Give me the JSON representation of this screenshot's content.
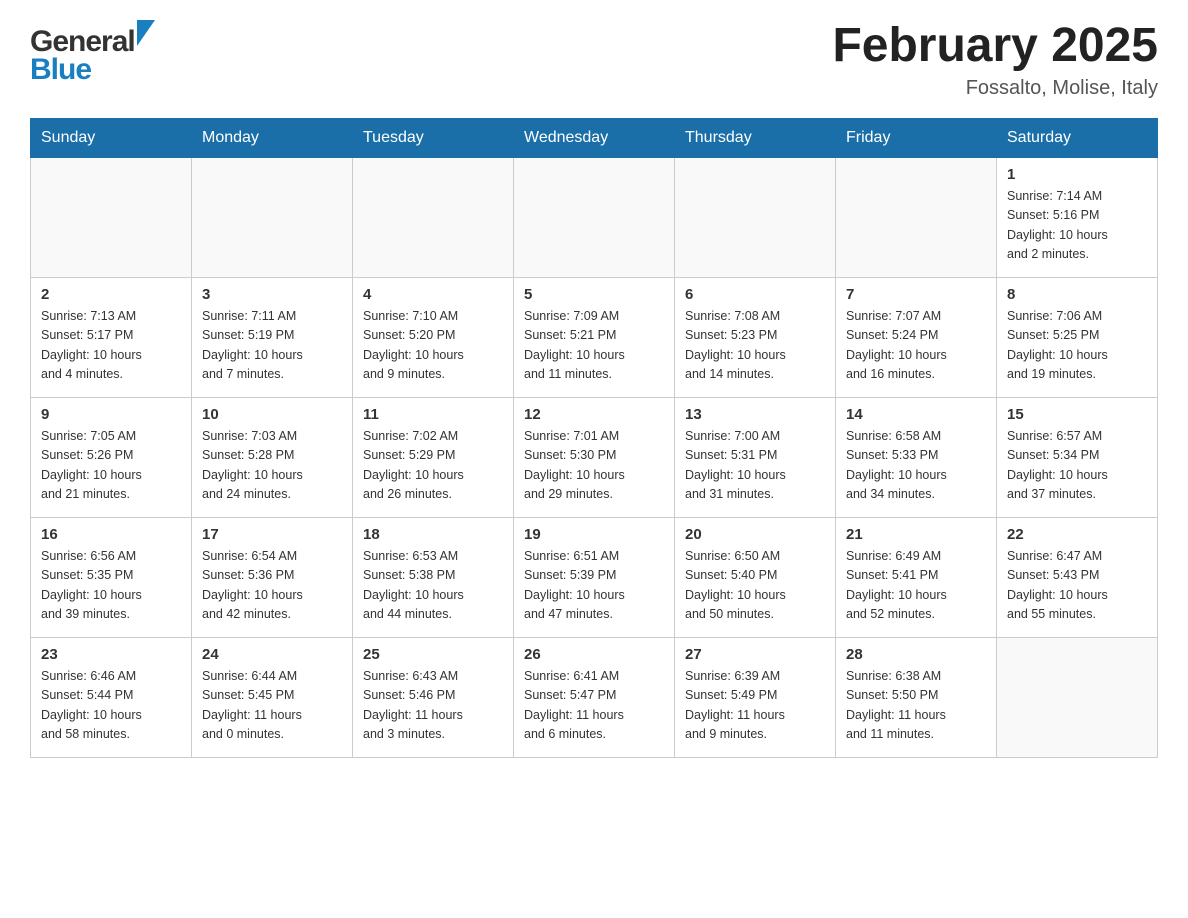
{
  "header": {
    "logo_general": "General",
    "logo_blue": "Blue",
    "title": "February 2025",
    "location": "Fossalto, Molise, Italy"
  },
  "calendar": {
    "days_of_week": [
      "Sunday",
      "Monday",
      "Tuesday",
      "Wednesday",
      "Thursday",
      "Friday",
      "Saturday"
    ],
    "weeks": [
      [
        {
          "day": "",
          "info": ""
        },
        {
          "day": "",
          "info": ""
        },
        {
          "day": "",
          "info": ""
        },
        {
          "day": "",
          "info": ""
        },
        {
          "day": "",
          "info": ""
        },
        {
          "day": "",
          "info": ""
        },
        {
          "day": "1",
          "info": "Sunrise: 7:14 AM\nSunset: 5:16 PM\nDaylight: 10 hours\nand 2 minutes."
        }
      ],
      [
        {
          "day": "2",
          "info": "Sunrise: 7:13 AM\nSunset: 5:17 PM\nDaylight: 10 hours\nand 4 minutes."
        },
        {
          "day": "3",
          "info": "Sunrise: 7:11 AM\nSunset: 5:19 PM\nDaylight: 10 hours\nand 7 minutes."
        },
        {
          "day": "4",
          "info": "Sunrise: 7:10 AM\nSunset: 5:20 PM\nDaylight: 10 hours\nand 9 minutes."
        },
        {
          "day": "5",
          "info": "Sunrise: 7:09 AM\nSunset: 5:21 PM\nDaylight: 10 hours\nand 11 minutes."
        },
        {
          "day": "6",
          "info": "Sunrise: 7:08 AM\nSunset: 5:23 PM\nDaylight: 10 hours\nand 14 minutes."
        },
        {
          "day": "7",
          "info": "Sunrise: 7:07 AM\nSunset: 5:24 PM\nDaylight: 10 hours\nand 16 minutes."
        },
        {
          "day": "8",
          "info": "Sunrise: 7:06 AM\nSunset: 5:25 PM\nDaylight: 10 hours\nand 19 minutes."
        }
      ],
      [
        {
          "day": "9",
          "info": "Sunrise: 7:05 AM\nSunset: 5:26 PM\nDaylight: 10 hours\nand 21 minutes."
        },
        {
          "day": "10",
          "info": "Sunrise: 7:03 AM\nSunset: 5:28 PM\nDaylight: 10 hours\nand 24 minutes."
        },
        {
          "day": "11",
          "info": "Sunrise: 7:02 AM\nSunset: 5:29 PM\nDaylight: 10 hours\nand 26 minutes."
        },
        {
          "day": "12",
          "info": "Sunrise: 7:01 AM\nSunset: 5:30 PM\nDaylight: 10 hours\nand 29 minutes."
        },
        {
          "day": "13",
          "info": "Sunrise: 7:00 AM\nSunset: 5:31 PM\nDaylight: 10 hours\nand 31 minutes."
        },
        {
          "day": "14",
          "info": "Sunrise: 6:58 AM\nSunset: 5:33 PM\nDaylight: 10 hours\nand 34 minutes."
        },
        {
          "day": "15",
          "info": "Sunrise: 6:57 AM\nSunset: 5:34 PM\nDaylight: 10 hours\nand 37 minutes."
        }
      ],
      [
        {
          "day": "16",
          "info": "Sunrise: 6:56 AM\nSunset: 5:35 PM\nDaylight: 10 hours\nand 39 minutes."
        },
        {
          "day": "17",
          "info": "Sunrise: 6:54 AM\nSunset: 5:36 PM\nDaylight: 10 hours\nand 42 minutes."
        },
        {
          "day": "18",
          "info": "Sunrise: 6:53 AM\nSunset: 5:38 PM\nDaylight: 10 hours\nand 44 minutes."
        },
        {
          "day": "19",
          "info": "Sunrise: 6:51 AM\nSunset: 5:39 PM\nDaylight: 10 hours\nand 47 minutes."
        },
        {
          "day": "20",
          "info": "Sunrise: 6:50 AM\nSunset: 5:40 PM\nDaylight: 10 hours\nand 50 minutes."
        },
        {
          "day": "21",
          "info": "Sunrise: 6:49 AM\nSunset: 5:41 PM\nDaylight: 10 hours\nand 52 minutes."
        },
        {
          "day": "22",
          "info": "Sunrise: 6:47 AM\nSunset: 5:43 PM\nDaylight: 10 hours\nand 55 minutes."
        }
      ],
      [
        {
          "day": "23",
          "info": "Sunrise: 6:46 AM\nSunset: 5:44 PM\nDaylight: 10 hours\nand 58 minutes."
        },
        {
          "day": "24",
          "info": "Sunrise: 6:44 AM\nSunset: 5:45 PM\nDaylight: 11 hours\nand 0 minutes."
        },
        {
          "day": "25",
          "info": "Sunrise: 6:43 AM\nSunset: 5:46 PM\nDaylight: 11 hours\nand 3 minutes."
        },
        {
          "day": "26",
          "info": "Sunrise: 6:41 AM\nSunset: 5:47 PM\nDaylight: 11 hours\nand 6 minutes."
        },
        {
          "day": "27",
          "info": "Sunrise: 6:39 AM\nSunset: 5:49 PM\nDaylight: 11 hours\nand 9 minutes."
        },
        {
          "day": "28",
          "info": "Sunrise: 6:38 AM\nSunset: 5:50 PM\nDaylight: 11 hours\nand 11 minutes."
        },
        {
          "day": "",
          "info": ""
        }
      ]
    ]
  }
}
